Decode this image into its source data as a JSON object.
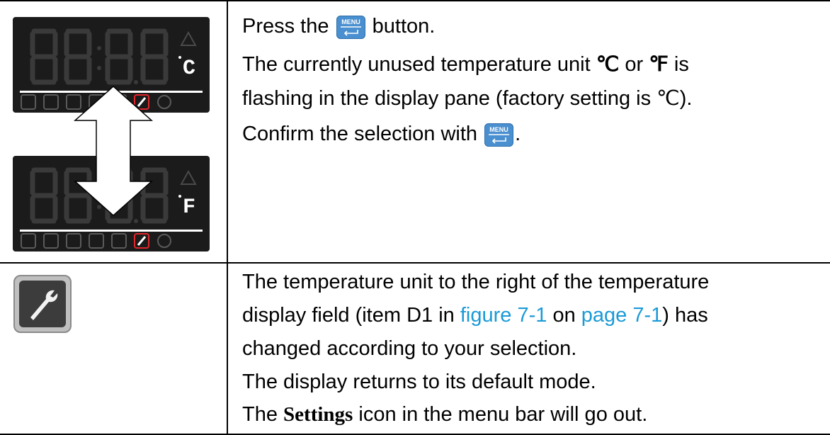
{
  "step1": {
    "line1_before": "Press the",
    "line1_after": "button.",
    "menu_button_label": "MENU",
    "line2_before": "The currently unused temperature unit",
    "unit_c": "℃",
    "line2_mid": "or",
    "unit_f": "℉",
    "line2_after": "is",
    "line3": "flashing in the display pane (factory setting is ℃).",
    "line4_before": "Confirm the selection with",
    "line4_after": "."
  },
  "display_top": {
    "unit_glyph": "C"
  },
  "display_bottom": {
    "unit_glyph": "F"
  },
  "step2": {
    "line1": "The temperature unit to the right of the temperature",
    "line2_before": "display field (item D1 in",
    "link_figure": "figure 7-1",
    "line2_mid": "on",
    "link_page": "page 7-1",
    "line2_after": ") has",
    "line3": "changed according to your selection.",
    "line4": "The display returns to its default mode.",
    "line5_before": "The",
    "line5_bold": "Settings",
    "line5_after": "icon in the menu bar will go out."
  },
  "icons": {
    "settings": "wrench-icon",
    "menu_bar": [
      "thermometer-icon",
      "fan-icon",
      "plug-icon",
      "light-icon",
      "thermometer-arrows-icon",
      "wrench-icon",
      "power-icon"
    ],
    "warning": "warning-icon",
    "swap_arrow": "double-arrow-icon"
  },
  "colors": {
    "menu_button": "#4a8fcf",
    "link": "#1a9ad6",
    "wrench_active": "#e0262b",
    "display_bg": "#1b1b1b"
  }
}
